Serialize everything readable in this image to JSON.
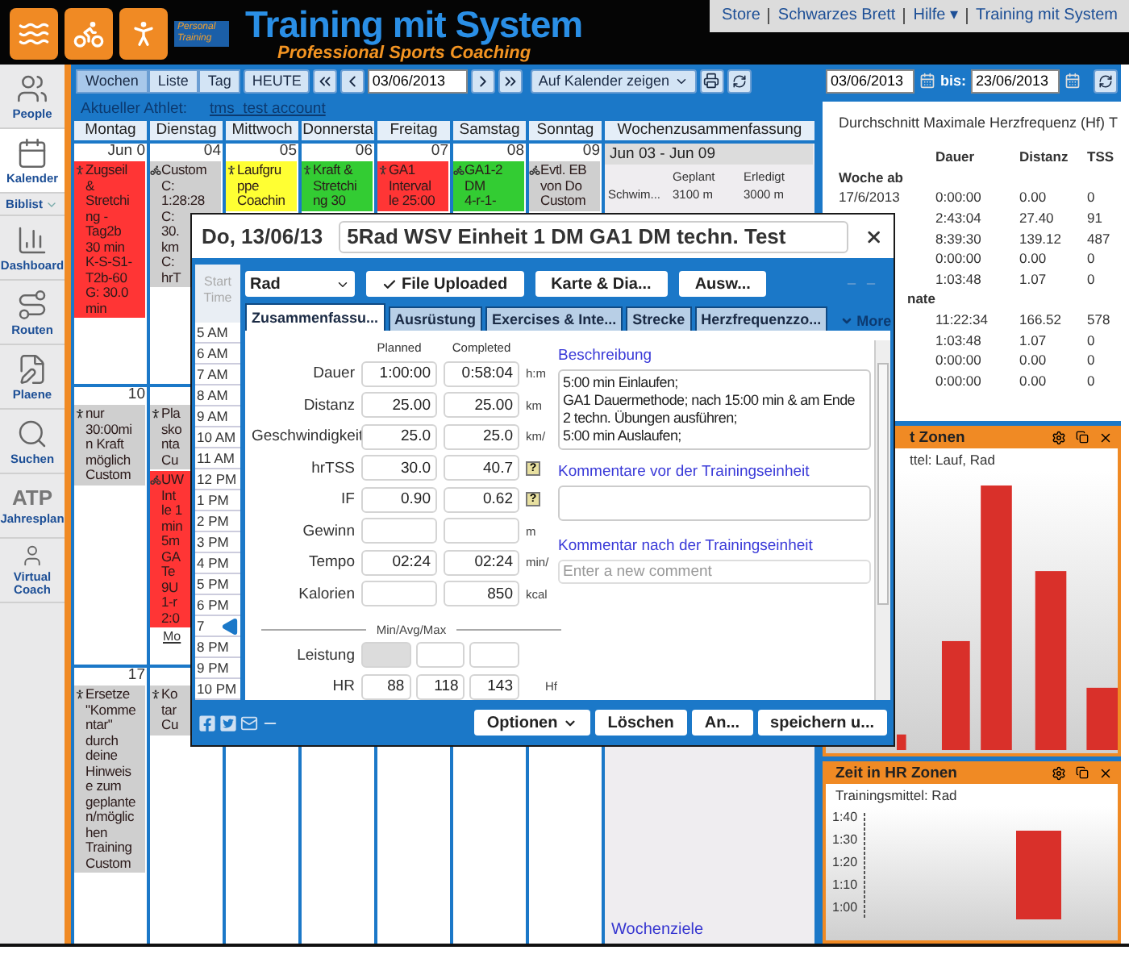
{
  "header": {
    "badge": "Personal Training",
    "brand": "Training mit System",
    "slogan": "Professional Sports Coaching"
  },
  "top_menu": [
    "Store",
    "Schwarzes Brett",
    "Hilfe ▾",
    "Training mit System"
  ],
  "sidebar": [
    {
      "kind": "people",
      "label": "People",
      "selected": false
    },
    {
      "kind": "calendar",
      "label": "Kalender",
      "selected": true
    },
    {
      "kind": "list",
      "label": "Biblist",
      "selected": false
    },
    {
      "kind": "dashboard",
      "label": "Dashboard",
      "selected": false
    },
    {
      "kind": "routes",
      "label": "Routen",
      "selected": false
    },
    {
      "kind": "plans",
      "label": "Plaene",
      "selected": false
    },
    {
      "kind": "search",
      "label": "Suchen",
      "selected": false
    },
    {
      "kind": "atp",
      "icon_text": "ATP",
      "label": "Jahresplan",
      "selected": false
    },
    {
      "kind": "coach",
      "label": "Virtual Coach",
      "selected": false
    }
  ],
  "toolbar": {
    "views": [
      {
        "label": "Wochen",
        "selected": true
      },
      {
        "label": "Liste",
        "selected": false
      },
      {
        "label": "Tag",
        "selected": false
      }
    ],
    "today": "HEUTE",
    "date": "03/06/2013",
    "show_on": "Auf Kalender zeigen"
  },
  "athlete": {
    "label": "Aktueller Athlet:",
    "name": "tms_test account"
  },
  "calendar": {
    "days": [
      "Montag",
      "Dienstag",
      "Mittwoch",
      "Donnersta",
      "Freitag",
      "Samstag",
      "Sonntag"
    ],
    "summary_title": "Wochenzusammenfassung",
    "weeks": [
      {
        "cells": [
          {
            "date": "Jun 0",
            "entries": [
              {
                "kind": "run",
                "color": "#ff3535",
                "lines": [
                  "Zugseil",
                  "&",
                  "Stretchi",
                  "ng -",
                  "Tag2b",
                  "30 min",
                  "K-S-S1-",
                  "T2b-60",
                  "G: 30.0",
                  "min"
                ]
              }
            ]
          },
          {
            "date": "04",
            "entries": [
              {
                "kind": "bike",
                "color": "#cfcfcf",
                "lines": [
                  "Custom",
                  "C:",
                  "1:28:28",
                  "C:",
                  "30.",
                  "km",
                  "C:",
                  "hrT"
                ]
              }
            ]
          },
          {
            "date": "05",
            "entries": [
              {
                "kind": "run",
                "color": "#ffff33",
                "lines": [
                  "Laufgru",
                  "ppe",
                  "Coachin"
                ]
              }
            ]
          },
          {
            "date": "06",
            "entries": [
              {
                "kind": "run",
                "color": "#33cc33",
                "lines": [
                  "Kraft &",
                  "Stretchi",
                  "ng 30"
                ]
              }
            ]
          },
          {
            "date": "07",
            "entries": [
              {
                "kind": "run",
                "color": "#ff3535",
                "lines": [
                  "GA1",
                  "Interval",
                  "le 25:00"
                ]
              }
            ]
          },
          {
            "date": "08",
            "entries": [
              {
                "kind": "bike",
                "color": "#33cc33",
                "lines": [
                  "GA1-2",
                  "DM",
                  "4-r-1-"
                ]
              }
            ]
          },
          {
            "date": "09",
            "entries": [
              {
                "kind": "bike",
                "color": "#cfcfcf",
                "lines": [
                  "Evtl. EB",
                  "von Do",
                  "Custom"
                ]
              }
            ]
          }
        ],
        "summary": {
          "range": "Jun 03 - Jun 09",
          "columns": [
            "Geplant",
            "Erledigt"
          ],
          "rows": [
            {
              "label": "Schwim...",
              "planned": "3100 m",
              "done": "3000 m"
            }
          ]
        }
      },
      {
        "cells": [
          {
            "date": "10",
            "entries": [
              {
                "kind": "run",
                "color": "#cfcfcf",
                "lines": [
                  "nur",
                  "30:00mi",
                  "n Kraft",
                  "möglich",
                  "Custom"
                ]
              }
            ]
          },
          {
            "entries": [
              {
                "kind": "run",
                "color": "#cfcfcf",
                "lines": [
                  "Pla",
                  "sko",
                  "nta",
                  "Cu"
                ]
              },
              {
                "kind": "bike",
                "color": "#ff3535",
                "lines": [
                  "UW",
                  "Int",
                  "le 1",
                  "min",
                  "5m",
                  "GA",
                  "Te",
                  "9U",
                  "1-r",
                  "2:0"
                ],
                "more": "Mo"
              }
            ]
          }
        ]
      },
      {
        "cells": [
          {
            "date": "17",
            "entries": [
              {
                "kind": "run",
                "color": "#cfcfcf",
                "lines": [
                  "Ersetze",
                  "\"Komme",
                  "ntar\"",
                  "durch",
                  "deine",
                  "Hinweis",
                  "e zum",
                  "geplante",
                  "n/möglic",
                  "hen",
                  "Training",
                  "Custom"
                ]
              }
            ]
          },
          {
            "entries": [
              {
                "kind": "run",
                "color": "#cfcfcf",
                "lines": [
                  "Ko",
                  "tar",
                  "Cu"
                ]
              }
            ]
          }
        ],
        "summary": {
          "goals": "Wochenziele"
        }
      }
    ]
  },
  "right": {
    "range": {
      "from": "03/06/2013",
      "to_label": "bis:",
      "to": "23/06/2013"
    },
    "stats": {
      "title": "Durchschnitt Maximale Herzfrequenz (Hf)",
      "next_title": "T",
      "columns": [
        "Dauer",
        "Distanz",
        "TSS"
      ],
      "groups": [
        {
          "label": "Woche ab",
          "rows": [
            {
              "date": "17/6/2013",
              "values": [
                "0:00:00",
                "0.00",
                "0"
              ]
            },
            {
              "values": [
                "2:43:04",
                "27.40",
                "91"
              ]
            },
            {
              "values": [
                "8:39:30",
                "139.12",
                "487"
              ]
            },
            {
              "values": [
                "0:00:00",
                "0.00",
                "0"
              ]
            },
            {
              "values": [
                "1:03:48",
                "1.07",
                "0"
              ]
            }
          ]
        },
        {
          "label": "nate",
          "rows": [
            {
              "values": [
                "11:22:34",
                "166.52",
                "578"
              ]
            },
            {
              "values": [
                "1:03:48",
                "1.07",
                "0"
              ]
            },
            {
              "values": [
                "0:00:00",
                "0.00",
                "0"
              ]
            },
            {
              "values": [
                "0:00:00",
                "0.00",
                "0"
              ]
            }
          ]
        }
      ]
    },
    "charts": [
      {
        "title": "t Zonen",
        "subtitle": "ttel: Lauf, Rad"
      },
      {
        "title": "Zeit in HR Zonen",
        "subtitle": "Trainingsmittel: Rad",
        "y_labels": [
          "1:40",
          "1:30",
          "1:20",
          "1:10",
          "1:00"
        ]
      }
    ]
  },
  "modal": {
    "date": "Do, 13/06/13",
    "title": "5Rad WSV Einheit 1 DM GA1 DM techn. Test",
    "sport": "Rad",
    "buttons": [
      {
        "kind": "check",
        "label": "File Uploaded"
      },
      {
        "kind": "plain",
        "label": "Karte & Dia..."
      },
      {
        "kind": "plain",
        "label": "Ausw..."
      }
    ],
    "start_time": "Start Time",
    "times": [
      {
        "label": "5 AM",
        "selected": false
      },
      {
        "label": "6 AM",
        "selected": false
      },
      {
        "label": "7 AM",
        "selected": false
      },
      {
        "label": "8 AM",
        "selected": false
      },
      {
        "label": "9 AM",
        "selected": false
      },
      {
        "label": "10 AM",
        "selected": false
      },
      {
        "label": "11 AM",
        "selected": false
      },
      {
        "label": "12 PM",
        "selected": false
      },
      {
        "label": "1 PM",
        "selected": false
      },
      {
        "label": "2 PM",
        "selected": false
      },
      {
        "label": "3 PM",
        "selected": false
      },
      {
        "label": "4 PM",
        "selected": false
      },
      {
        "label": "5 PM",
        "selected": false
      },
      {
        "label": "6 PM",
        "selected": false
      },
      {
        "label": "7",
        "selected": true
      },
      {
        "label": "8 PM",
        "selected": false
      },
      {
        "label": "9 PM",
        "selected": false
      },
      {
        "label": "10 PM",
        "selected": false
      }
    ],
    "tabs": [
      {
        "label": "Zusammenfassu...",
        "selected": true
      },
      {
        "label": "Ausrüstung",
        "selected": false
      },
      {
        "label": "Exercises & Inte...",
        "selected": false
      },
      {
        "label": "Strecke",
        "selected": false
      },
      {
        "label": "Herzfrequenzzo...",
        "selected": false
      }
    ],
    "more": "More",
    "form": {
      "headers": [
        "Planned",
        "Completed"
      ],
      "rows": [
        {
          "label": "Dauer",
          "planned": "1:00:00",
          "completed": "0:58:04",
          "unit": "h:m"
        },
        {
          "label": "Distanz",
          "planned": "25.00",
          "completed": "25.00",
          "unit": "km"
        },
        {
          "label": "Geschwindigkeit",
          "planned": "25.0",
          "completed": "25.0",
          "unit": "km/"
        },
        {
          "label": "hrTSS",
          "planned": "30.0",
          "completed": "40.7",
          "help": "?"
        },
        {
          "label": "IF",
          "planned": "0.90",
          "completed": "0.62",
          "help": "?"
        },
        {
          "label": "Gewinn",
          "unit": "m"
        },
        {
          "label": "Tempo",
          "planned": "02:24",
          "completed": "02:24",
          "unit": "min/"
        },
        {
          "label": "Kalorien",
          "completed": "850",
          "unit": "kcal"
        }
      ]
    },
    "minmax": {
      "title": "Min/Avg/Max",
      "rows": [
        {
          "label": "Leistung",
          "fields": [
            {
              "disabled": true
            },
            {
              "disabled": false
            },
            {
              "disabled": false
            }
          ]
        },
        {
          "label": "HR",
          "fields": [
            {
              "value": "88",
              "disabled": false
            },
            {
              "value": "118",
              "disabled": false
            },
            {
              "value": "143",
              "disabled": false
            }
          ],
          "unit": "Hf"
        }
      ]
    },
    "description": {
      "title": "Beschreibung",
      "text": "5:00 min Einlaufen;\nGA1 Dauermethode; nach 15:00 min & am Ende\n2 techn. Übungen ausführen;\n5:00 min Auslaufen;"
    },
    "comment_before": {
      "title": "Kommentare vor der Trainingseinheit"
    },
    "comment_after": {
      "title": "Kommentar nach der Trainingseinheit",
      "placeholder": "Enter a new comment"
    },
    "footer_buttons": [
      {
        "label": "Optionen",
        "dropdown": true
      },
      {
        "label": "Löschen",
        "dropdown": false
      },
      {
        "label": "An...",
        "dropdown": false
      },
      {
        "label": "speichern u...",
        "dropdown": false
      }
    ]
  }
}
